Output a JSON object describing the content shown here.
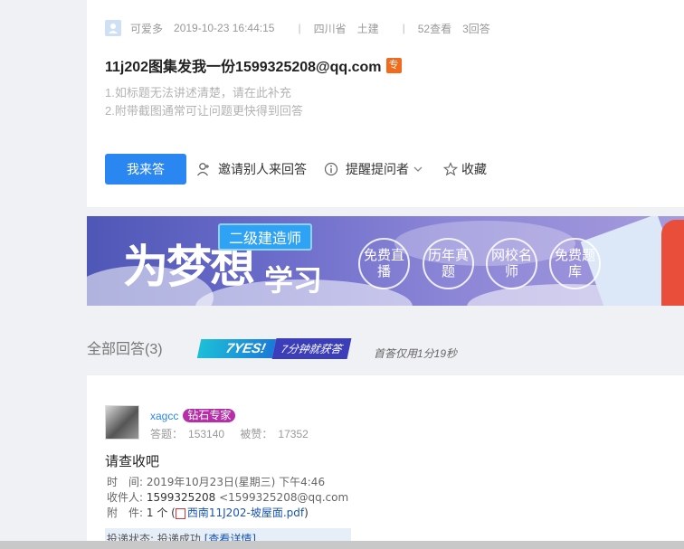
{
  "question": {
    "author": "可爱多",
    "datetime": "2019-10-23 16:44:15",
    "province": "四川省",
    "category": "土建",
    "views": "52查看",
    "answers": "3回答",
    "title": "11j202图集发我一份1599325208@qq.com",
    "tag": "专",
    "hint1": "1.如标题无法讲述清楚，请在此补充",
    "hint2": "2.附带截图通常可让问题更快得到回答",
    "answer_button": "我来答",
    "invite_label": "邀请别人来回答",
    "remind_label": "提醒提问者",
    "favorite_label": "收藏"
  },
  "banner": {
    "slogan_big": "为梦想",
    "slogan_small": "学习",
    "badge": "二级建造师",
    "circles": [
      "免费直播",
      "历年真题",
      "网校名师",
      "免费题库"
    ]
  },
  "answers_section": {
    "title": "全部回答(3)",
    "logo_main": "7YES!",
    "logo_sub": "7分钟就获答",
    "first_answer": "首答仅用1分19秒"
  },
  "answer": {
    "username": "xagcc",
    "badge": "钻石专家",
    "answers_label": "答题：",
    "answers_count": "153140",
    "likes_label": "被赞：",
    "likes_count": "17352",
    "text": "请查收吧",
    "mail": {
      "time_label": "时　间:",
      "time_value": "2019年10月23日(星期三) 下午4:46",
      "to_label": "收件人:",
      "to_value": "1599325208",
      "to_email": "<1599325208@qq.com",
      "attach_label": "附　件:",
      "attach_count": "1 个 (",
      "attach_file": "西南11J202-坡屋面.pdf",
      "attach_close": ")",
      "status_label": "投递状态:",
      "status_value": "投递成功",
      "status_link": "[查看详情]"
    }
  }
}
